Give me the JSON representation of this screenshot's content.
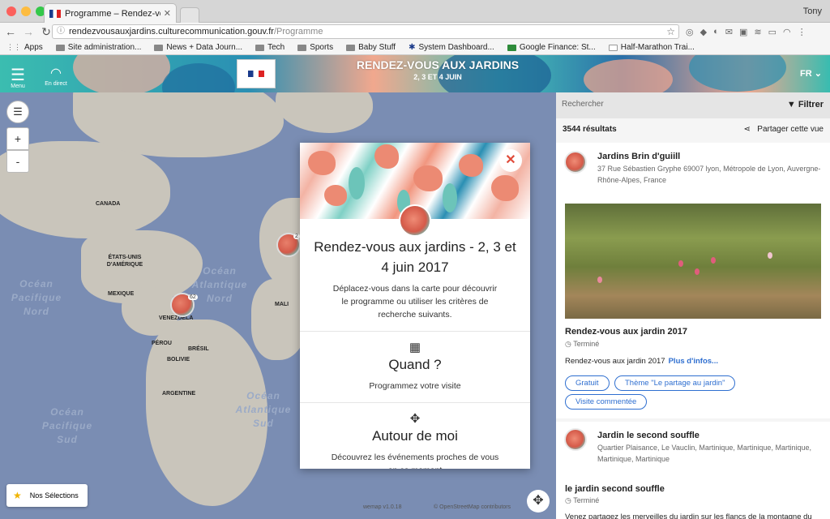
{
  "browser": {
    "tab_title": "Programme – Rendez-vous aux jardins",
    "user": "Tony",
    "url_host": "rendezvousauxjardins.culturecommunication.gouv.fr",
    "url_path": "/Programme",
    "bookmarks": [
      "Apps",
      "Site administration...",
      "News + Data Journ...",
      "Tech",
      "Sports",
      "Baby Stuff",
      "System Dashboard...",
      "Google Finance: St...",
      "Half-Marathon Trai..."
    ]
  },
  "banner": {
    "menu_label": "Menu",
    "live_label": "En direct",
    "title": "RENDEZ-VOUS AUX JARDINS",
    "subtitle": "2, 3 ET 4 JUIN",
    "lang": "FR"
  },
  "map": {
    "zoom_in": "+",
    "zoom_out": "-",
    "labels": [
      "CANADA",
      "ÉTATS-UNIS D'AMÉRIQUE",
      "MEXIQUE",
      "VENEZUELA",
      "PÉROU",
      "BRÉSIL",
      "BOLIVIE",
      "ARGENTINE",
      "MALI"
    ],
    "oceans": [
      "Océan Pacifique Nord",
      "Océan Atlantique Nord",
      "Océan Atlantique Sud",
      "Océan Pacifique Sud"
    ],
    "clusters": [
      "62",
      "2"
    ],
    "selections_label": "Nos Sélections",
    "wemap": "wemap v1.0.18",
    "osm": "© OpenStreetMap contributors"
  },
  "modal": {
    "title": "Rendez-vous aux jardins - 2, 3 et 4 juin 2017",
    "description": "Déplacez-vous dans la carte pour découvrir le programme ou utiliser les critères de recherche suivants.",
    "when_title": "Quand ?",
    "when_sub": "Programmez votre visite",
    "around_title": "Autour de moi",
    "around_sub": "Découvrez les événements proches de vous en ce moment"
  },
  "panel": {
    "search_placeholder": "Rechercher",
    "filter_label": "Filtrer",
    "results": "3544 résultats",
    "share_label": "Partager cette vue",
    "items": [
      {
        "name": "Jardins Brin d'guiill",
        "address": "37 Rue Sébastien Gryphe 69007 lyon, Métropole de Lyon, Auvergne-Rhône-Alpes, France",
        "event_title": "Rendez-vous aux jardin 2017",
        "status": "Terminé",
        "event_line": "Rendez-vous aux jardin 2017",
        "more": "Plus d'infos...",
        "tags": [
          "Gratuit",
          "Thème \"Le partage au jardin\"",
          "Visite commentée"
        ]
      },
      {
        "name": "Jardin le second souffle",
        "address": "Quartier Plaisance, Le Vauclin, Martinique, Martinique, Martinique, Martinique, Martinique",
        "event_title": "le jardin second souffle",
        "status": "Terminé",
        "event_line": "Venez partagez les merveilles du jardin sur les flancs de la montagne du"
      }
    ]
  }
}
